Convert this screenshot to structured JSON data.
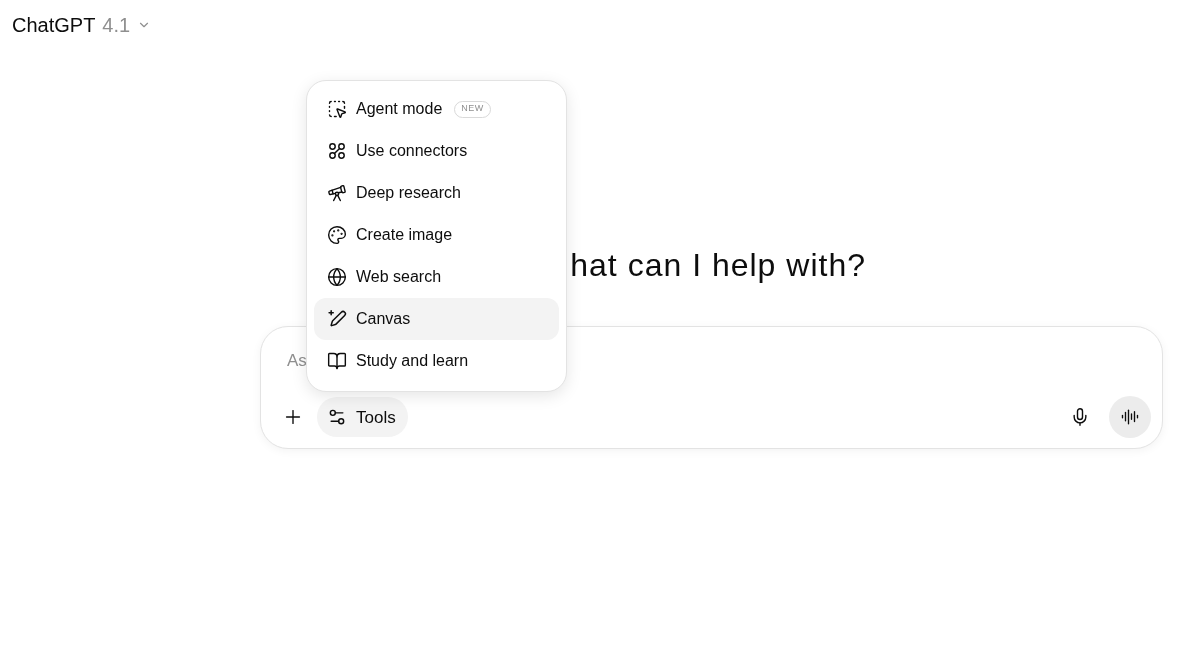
{
  "header": {
    "title": "ChatGPT",
    "version": "4.1"
  },
  "heading": "hat can I help with?",
  "composer": {
    "placeholder": "As",
    "tools_button": "Tools"
  },
  "tools_menu": {
    "items": [
      {
        "label": "Agent mode",
        "badge": "NEW",
        "highlighted": false
      },
      {
        "label": "Use connectors",
        "highlighted": false
      },
      {
        "label": "Deep research",
        "highlighted": false
      },
      {
        "label": "Create image",
        "highlighted": false
      },
      {
        "label": "Web search",
        "highlighted": false
      },
      {
        "label": "Canvas",
        "highlighted": true
      },
      {
        "label": "Study and learn",
        "highlighted": false
      }
    ]
  }
}
